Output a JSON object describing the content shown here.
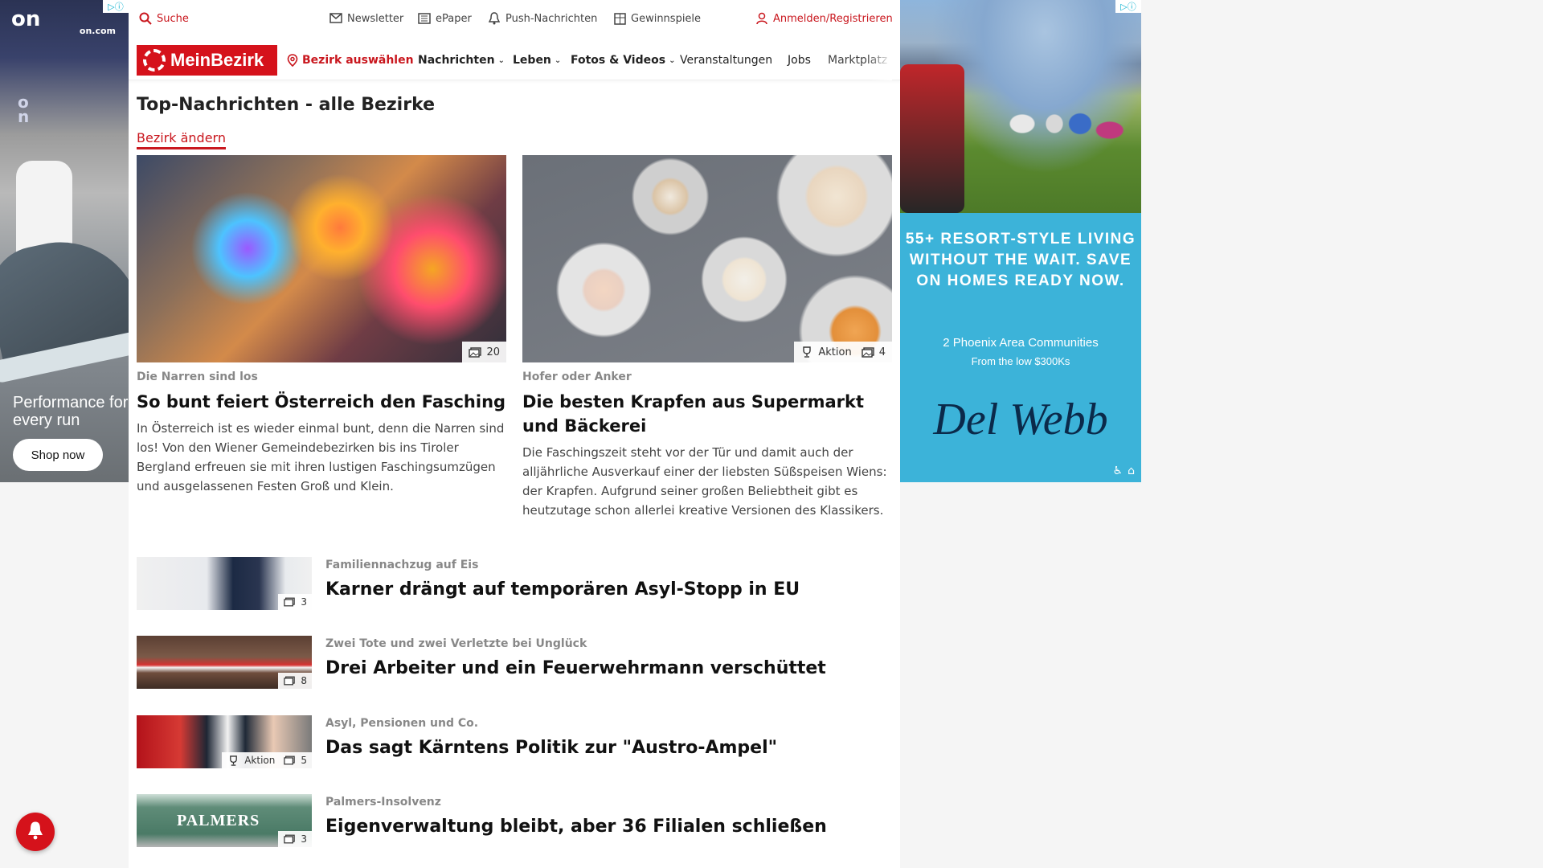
{
  "ads": {
    "left": {
      "logo": "on",
      "domain": "on.com",
      "tagline": "Performance for every run",
      "cta": "Shop now"
    },
    "right": {
      "headline": "55+ RESORT-STYLE LIVING WITHOUT THE WAIT. SAVE ON HOMES READY NOW.",
      "sub": "2 Phoenix Area Communities",
      "sub2": "From the low $300Ks",
      "brand": "Del Webb"
    }
  },
  "topbar": {
    "search": "Suche",
    "newsletter": "Newsletter",
    "epaper": "ePaper",
    "push": "Push-Nachrichten",
    "gewinnspiele": "Gewinnspiele",
    "login": "Anmelden/Registrieren"
  },
  "nav": {
    "logo": "MeinBezirk",
    "bezirk": "Bezirk auswählen",
    "items": [
      "Nachrichten",
      "Leben",
      "Fotos & Videos",
      "Veranstaltungen",
      "Jobs",
      "Marktplatz"
    ]
  },
  "section": {
    "title": "Top-Nachrichten - alle Bezirke",
    "change": "Bezirk ändern"
  },
  "features": [
    {
      "kicker": "Die Narren sind los",
      "headline": "So bunt feiert Österreich den Fasching",
      "teaser": "In Österreich ist es wieder einmal bunt, denn die Narren sind los! Von den Wiener Gemeindebezirken bis ins Tiroler Bergland erfreuen sie mit ihren lustigen Faschingsumzügen und ausgelassenen Festen Groß und Klein.",
      "photos": "20"
    },
    {
      "kicker": "Hofer oder Anker",
      "headline": "Die besten Krapfen aus Supermarkt und Bäckerei",
      "teaser": "Die Faschingszeit steht vor der Tür und damit auch der alljährliche Ausverkauf einer der liebsten Süßspeisen Wiens: der Krapfen. Aufgrund seiner großen Beliebtheit gibt es heutzutage schon allerlei kreative Versionen des Klassikers.",
      "aktion": "Aktion",
      "photos": "4"
    }
  ],
  "list": [
    {
      "kicker": "Familiennachzug auf Eis",
      "headline": "Karner drängt auf temporären Asyl-Stopp in EU",
      "photos": "3"
    },
    {
      "kicker": "Zwei Tote und zwei Verletzte bei Unglück",
      "headline": "Drei Arbeiter und ein Feuerwehrmann verschüttet",
      "photos": "8"
    },
    {
      "kicker": "Asyl, Pensionen und Co.",
      "headline": "Das sagt Kärntens Politik zur \"Austro-Ampel\"",
      "aktion": "Aktion",
      "photos": "5"
    },
    {
      "kicker": "Palmers-Insolvenz",
      "headline": "Eigenverwaltung bleibt, aber 36 Filialen schließen",
      "photos": "3",
      "thumb_text": "PALMERS"
    }
  ],
  "colors": {
    "brand": "#d5121b",
    "ad_right_bg": "#3cb3d9"
  }
}
